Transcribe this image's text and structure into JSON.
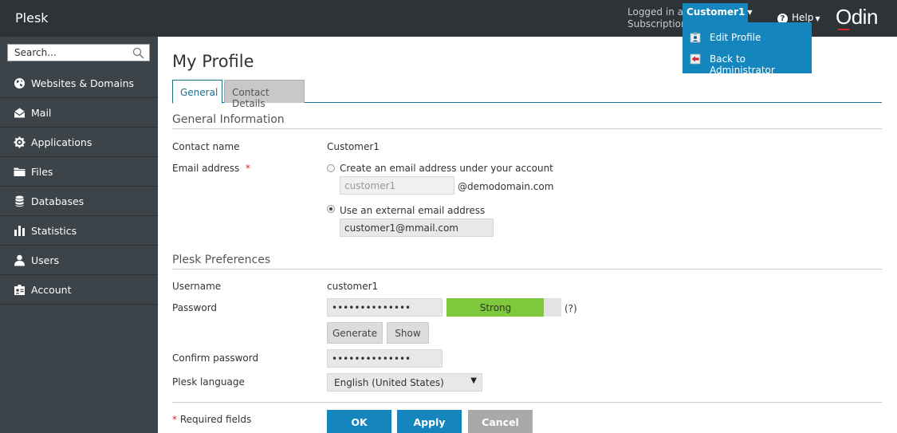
{
  "header": {
    "brand": "Plesk",
    "logged_in_as": "Logged in as",
    "subscription": "Subscription",
    "user": "Customer1",
    "help": "Help",
    "logo": "Odin"
  },
  "user_menu": {
    "items": [
      {
        "label": "Edit Profile",
        "icon": "edit-profile-icon"
      },
      {
        "label": "Back to Administrator",
        "icon": "back-icon"
      }
    ]
  },
  "sidebar": {
    "search_placeholder": "Search...",
    "items": [
      {
        "label": "Websites & Domains",
        "icon": "globe-icon"
      },
      {
        "label": "Mail",
        "icon": "mail-icon"
      },
      {
        "label": "Applications",
        "icon": "gear-icon"
      },
      {
        "label": "Files",
        "icon": "folder-icon"
      },
      {
        "label": "Databases",
        "icon": "database-icon"
      },
      {
        "label": "Statistics",
        "icon": "bar-chart-icon"
      },
      {
        "label": "Users",
        "icon": "user-icon"
      },
      {
        "label": "Account",
        "icon": "account-icon"
      }
    ]
  },
  "page": {
    "title": "My Profile",
    "tabs": [
      "General",
      "Contact Details"
    ]
  },
  "general_info": {
    "heading": "General Information",
    "contact_name_label": "Contact name",
    "contact_name_value": "Customer1",
    "email_label": "Email address",
    "required_mark": "*",
    "radio_create_label": "Create an email address under your account",
    "create_email_value": "customer1",
    "domain_suffix": "@demodomain.com",
    "radio_external_label": "Use an external email address",
    "external_email_value": "customer1@mmail.com"
  },
  "preferences": {
    "heading": "Plesk Preferences",
    "username_label": "Username",
    "username_value": "customer1",
    "password_label": "Password",
    "password_value": "••••••••••••••",
    "strength_label": "Strong",
    "strength_level": 0.85,
    "help_mark": "(?)",
    "generate_label": "Generate",
    "show_label": "Show",
    "confirm_label": "Confirm password",
    "confirm_value": "••••••••••••••",
    "language_label": "Plesk language",
    "language_value": "English (United States)"
  },
  "footer": {
    "required_note": "* Required fields",
    "ok": "OK",
    "apply": "Apply",
    "cancel": "Cancel"
  },
  "colors": {
    "topbar": "#2e3338",
    "sidebar": "#3c4349",
    "accent": "#1585be",
    "strength": "#7ec83c"
  }
}
